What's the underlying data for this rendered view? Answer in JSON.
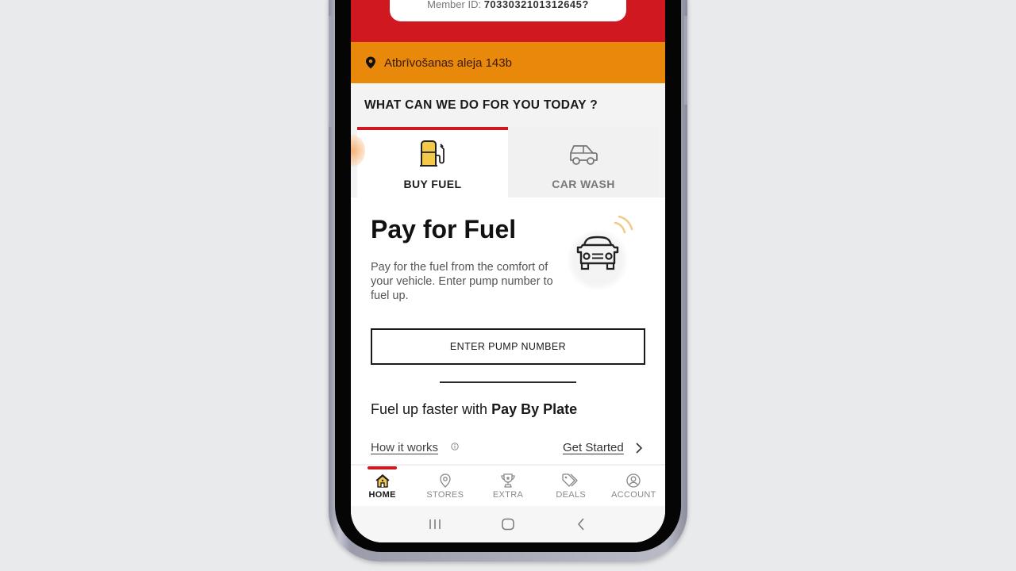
{
  "member": {
    "label": "Member ID:",
    "id": "7033032101312645?"
  },
  "location": {
    "icon": "location-pin-icon",
    "address": "Atbrīvošanas aleja 143b"
  },
  "question": "WHAT CAN WE DO FOR YOU TODAY ?",
  "tabs": [
    {
      "label": "BUY FUEL",
      "icon": "fuel-pump-icon",
      "active": true
    },
    {
      "label": "CAR WASH",
      "icon": "car-icon",
      "active": false
    }
  ],
  "main": {
    "title": "Pay for Fuel",
    "description": "Pay for the fuel from the comfort of your vehicle. Enter pump number to fuel up.",
    "pump_button": "ENTER PUMP NUMBER",
    "plate_prefix": "Fuel up faster with ",
    "plate_bold": "Pay By Plate",
    "how_it_works": "How it works",
    "get_started": "Get Started"
  },
  "bottom_nav": [
    {
      "label": "HOME",
      "icon": "home-icon",
      "active": true
    },
    {
      "label": "STORES",
      "icon": "map-pin-icon",
      "active": false
    },
    {
      "label": "EXTRA",
      "icon": "trophy-icon",
      "active": false
    },
    {
      "label": "DEALS",
      "icon": "tag-icon",
      "active": false
    },
    {
      "label": "ACCOUNT",
      "icon": "user-circle-icon",
      "active": false
    }
  ],
  "system_nav": [
    "recents-button",
    "home-button",
    "back-button"
  ],
  "colors": {
    "brand_red": "#cf1820",
    "brand_orange": "#e8890b",
    "fuel_yellow": "#f3c94a"
  }
}
